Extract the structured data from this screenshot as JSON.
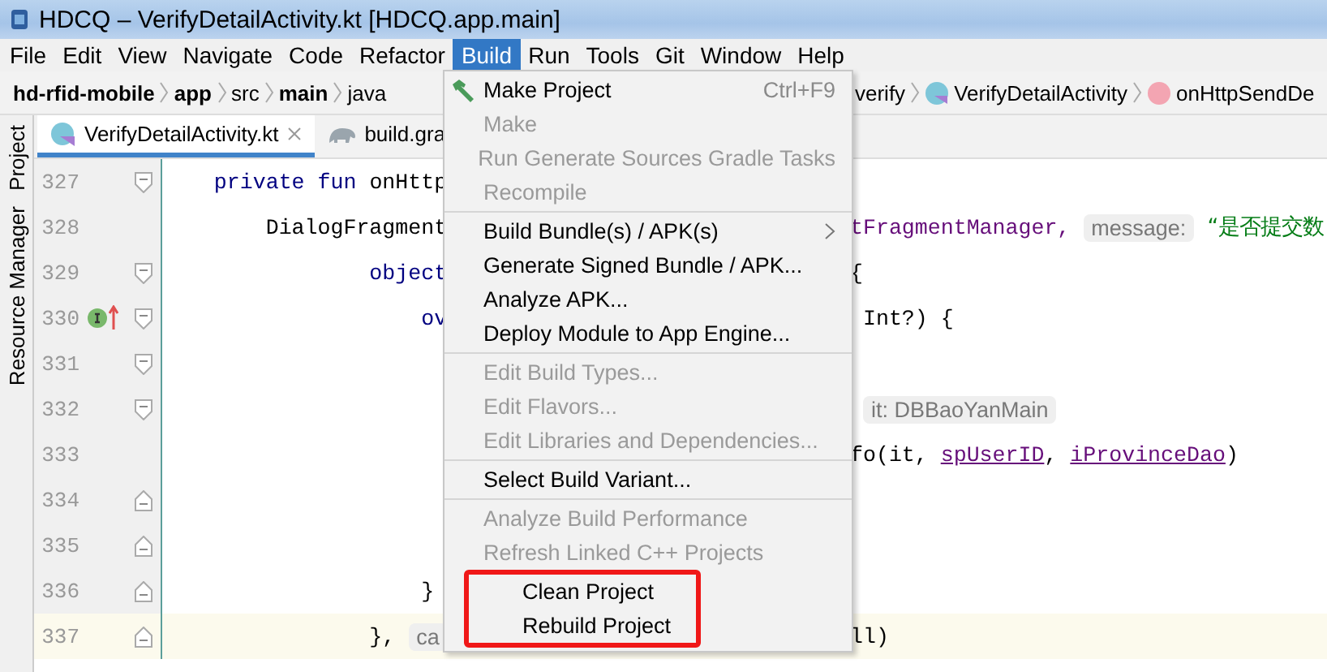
{
  "window": {
    "title": "HDCQ – VerifyDetailActivity.kt [HDCQ.app.main]"
  },
  "menu_bar": [
    {
      "label": "File",
      "selected": false
    },
    {
      "label": "Edit",
      "selected": false
    },
    {
      "label": "View",
      "selected": false
    },
    {
      "label": "Navigate",
      "selected": false
    },
    {
      "label": "Code",
      "selected": false
    },
    {
      "label": "Refactor",
      "selected": false
    },
    {
      "label": "Build",
      "selected": true
    },
    {
      "label": "Run",
      "selected": false
    },
    {
      "label": "Tools",
      "selected": false
    },
    {
      "label": "Git",
      "selected": false
    },
    {
      "label": "Window",
      "selected": false
    },
    {
      "label": "Help",
      "selected": false
    }
  ],
  "breadcrumb": {
    "left": [
      {
        "label": "hd-rfid-mobile",
        "kind": "bold"
      },
      {
        "label": "app",
        "kind": "bold"
      },
      {
        "label": "src",
        "kind": "plain"
      },
      {
        "label": "main",
        "kind": "bold"
      },
      {
        "label": "java",
        "kind": "plain"
      }
    ],
    "right": [
      {
        "label": "verify",
        "kind": "plain"
      },
      {
        "label": "VerifyDetailActivity",
        "kind": "class"
      },
      {
        "label": "onHttpSendDe",
        "kind": "method"
      }
    ]
  },
  "tool_strip": [
    "Project",
    "Resource Manager"
  ],
  "tabs": [
    {
      "label": "VerifyDetailActivity.kt",
      "selected": true,
      "kind": "kotlin"
    },
    {
      "label": "build.gra",
      "selected": false,
      "kind": "gradle"
    }
  ],
  "code_lines": [
    {
      "number": "327",
      "current": false,
      "gutter_icons": [
        {
          "kind": "fold_start"
        }
      ],
      "left": [
        {
          "kind": "keyword",
          "text": "    private fun "
        },
        {
          "kind": "plain",
          "text": "onHttp"
        }
      ]
    },
    {
      "number": "328",
      "current": false,
      "left": [
        {
          "kind": "plain",
          "text": "        DialogFragment"
        }
      ],
      "right": [
        {
          "kind": "member",
          "text": "tFragmentManager,"
        },
        {
          "kind": "hint",
          "text": "message:"
        },
        {
          "kind": "string",
          "text": "“是否提交数"
        }
      ]
    },
    {
      "number": "329",
      "current": false,
      "gutter_icons": [
        {
          "kind": "fold_start"
        }
      ],
      "left": [
        {
          "kind": "keyword",
          "text": "                object"
        }
      ],
      "right": [
        {
          "kind": "plain",
          "text": "{"
        }
      ]
    },
    {
      "number": "330",
      "current": false,
      "gutter_icons": [
        {
          "kind": "implements"
        },
        {
          "kind": "override"
        },
        {
          "kind": "fold_start"
        }
      ],
      "left": [
        {
          "kind": "keyword",
          "text": "                    ov"
        }
      ],
      "right": [
        {
          "kind": "plain",
          "text": " Int?) {"
        }
      ]
    },
    {
      "number": "331",
      "current": false,
      "gutter_icons": [
        {
          "kind": "fold_start"
        }
      ]
    },
    {
      "number": "332",
      "current": false,
      "gutter_icons": [
        {
          "kind": "fold_start"
        }
      ],
      "right": [
        {
          "kind": "hint",
          "text": "it: DBBaoYanMain"
        }
      ]
    },
    {
      "number": "333",
      "current": false,
      "right": [
        {
          "kind": "plain",
          "text": "fo(it, "
        },
        {
          "kind": "field",
          "text": "spUserID"
        },
        {
          "kind": "plain",
          "text": ", "
        },
        {
          "kind": "field",
          "text": "iProvinceDao"
        },
        {
          "kind": "plain",
          "text": ")"
        }
      ]
    },
    {
      "number": "334",
      "current": false,
      "gutter_icons": [
        {
          "kind": "fold_end"
        }
      ]
    },
    {
      "number": "335",
      "current": false,
      "gutter_icons": [
        {
          "kind": "fold_end"
        }
      ]
    },
    {
      "number": "336",
      "current": false,
      "gutter_icons": [
        {
          "kind": "fold_end"
        }
      ],
      "left": [
        {
          "kind": "plain",
          "text": "                    }"
        }
      ]
    },
    {
      "number": "337",
      "current": true,
      "gutter_icons": [
        {
          "kind": "fold_end"
        }
      ],
      "left": [
        {
          "kind": "plain",
          "text": "                },"
        },
        {
          "kind": "hint",
          "text": "ca"
        }
      ],
      "right": [
        {
          "kind": "plain",
          "text": "ll)"
        }
      ]
    }
  ],
  "build_menu": [
    {
      "kind": "item",
      "label": "Make Project",
      "shortcut": "Ctrl+F9",
      "disabled": false,
      "highlighted": false
    },
    {
      "kind": "item",
      "label": "Make",
      "disabled": true,
      "highlighted": false
    },
    {
      "kind": "item",
      "label": "Run Generate Sources Gradle Tasks",
      "disabled": true,
      "highlighted": false
    },
    {
      "kind": "item",
      "label": "Recompile",
      "disabled": true,
      "highlighted": false
    },
    {
      "kind": "separator"
    },
    {
      "kind": "item",
      "label": "Build Bundle(s) / APK(s)",
      "submenu": true,
      "disabled": false,
      "highlighted": false
    },
    {
      "kind": "item",
      "label": "Generate Signed Bundle / APK...",
      "disabled": false,
      "highlighted": false
    },
    {
      "kind": "item",
      "label": "Analyze APK...",
      "disabled": false,
      "highlighted": false
    },
    {
      "kind": "item",
      "label": "Deploy Module to App Engine...",
      "disabled": false,
      "highlighted": false
    },
    {
      "kind": "separator"
    },
    {
      "kind": "item",
      "label": "Edit Build Types...",
      "disabled": true,
      "highlighted": false
    },
    {
      "kind": "item",
      "label": "Edit Flavors...",
      "disabled": true,
      "highlighted": false
    },
    {
      "kind": "item",
      "label": "Edit Libraries and Dependencies...",
      "disabled": true,
      "highlighted": false
    },
    {
      "kind": "separator"
    },
    {
      "kind": "item",
      "label": "Select Build Variant...",
      "disabled": false,
      "highlighted": false
    },
    {
      "kind": "separator"
    },
    {
      "kind": "item",
      "label": "Analyze Build Performance",
      "disabled": true,
      "highlighted": false
    },
    {
      "kind": "item",
      "label": "Refresh Linked C++ Projects",
      "disabled": true,
      "highlighted": false
    },
    {
      "kind": "item",
      "label": "Clean Project",
      "disabled": false,
      "highlighted": true
    },
    {
      "kind": "item",
      "label": "Rebuild Project",
      "disabled": false,
      "highlighted": true
    }
  ]
}
